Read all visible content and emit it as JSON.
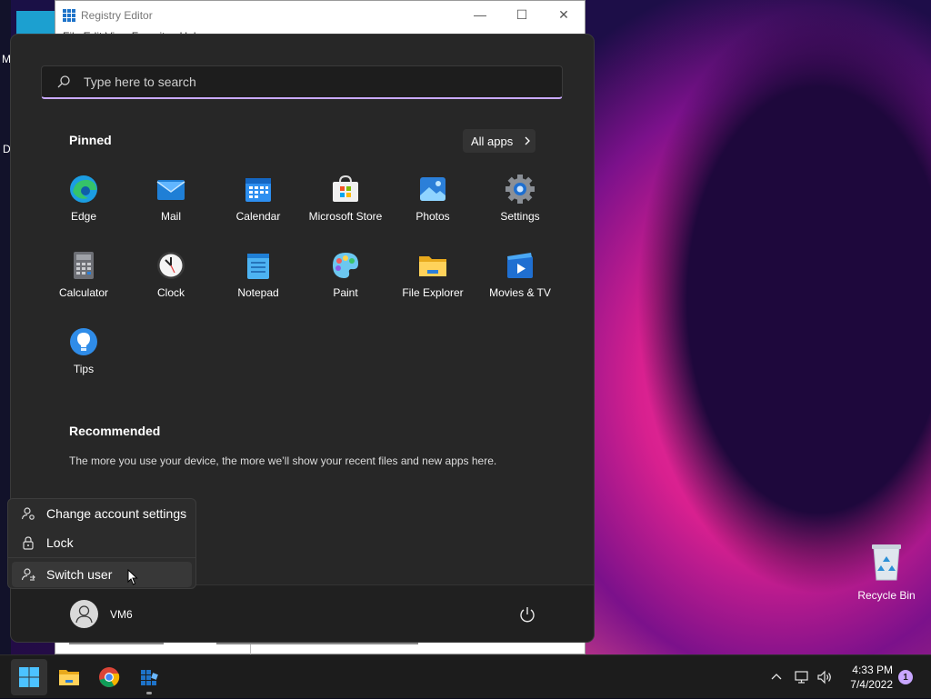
{
  "desktop": {
    "fragment_m": "M",
    "fragment_da": "Da",
    "recycle_bin_label": "Recycle Bin"
  },
  "regedit": {
    "title": "Registry Editor",
    "menu_partial": "File  Edit  View  Favorites  Help"
  },
  "start_menu": {
    "search_placeholder": "Type here to search",
    "pinned_title": "Pinned",
    "all_apps_label": "All apps",
    "pinned_apps": [
      {
        "label": "Edge",
        "icon": "edge-icon"
      },
      {
        "label": "Mail",
        "icon": "mail-icon"
      },
      {
        "label": "Calendar",
        "icon": "calendar-icon"
      },
      {
        "label": "Microsoft Store",
        "icon": "store-icon"
      },
      {
        "label": "Photos",
        "icon": "photos-icon"
      },
      {
        "label": "Settings",
        "icon": "settings-icon"
      },
      {
        "label": "Calculator",
        "icon": "calculator-icon"
      },
      {
        "label": "Clock",
        "icon": "clock-icon"
      },
      {
        "label": "Notepad",
        "icon": "notepad-icon"
      },
      {
        "label": "Paint",
        "icon": "paint-icon"
      },
      {
        "label": "File Explorer",
        "icon": "folder-icon"
      },
      {
        "label": "Movies & TV",
        "icon": "movies-icon"
      },
      {
        "label": "Tips",
        "icon": "tips-icon"
      }
    ],
    "recommended_title": "Recommended",
    "recommended_text": "The more you use your device, the more we’ll show your recent files and new apps here.",
    "user_name": "VM6"
  },
  "account_menu": {
    "change_settings": "Change account settings",
    "lock": "Lock",
    "switch_user": "Switch user"
  },
  "taskbar": {
    "time": "4:33 PM",
    "date": "7/4/2022",
    "notification_count": "1"
  },
  "colors": {
    "start_bg": "#272727",
    "accent": "#c9a9ff",
    "taskbar_bg": "#1c1c1c"
  }
}
